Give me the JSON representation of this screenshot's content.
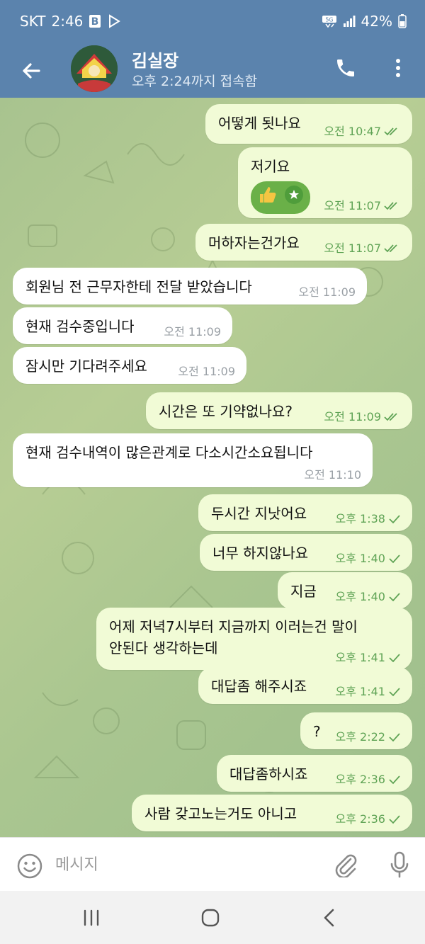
{
  "status_bar": {
    "carrier": "SKT",
    "time": "2:46",
    "battery": "42%"
  },
  "header": {
    "name": "김실장",
    "status": "오후 2:24까지 접속함"
  },
  "messages": [
    {
      "dir": "out",
      "text": "어떻게 됫나요",
      "time": "오전 10:47",
      "read": true
    },
    {
      "dir": "out",
      "text": "저기요",
      "time": "오전 11:07",
      "read": true,
      "emoji": [
        "thumbs-up",
        "star"
      ]
    },
    {
      "dir": "out",
      "text": "머하자는건가요",
      "time": "오전 11:07",
      "read": true
    },
    {
      "dir": "in",
      "text": "회원님 전 근무자한테 전달 받았습니다",
      "time": "오전 11:09"
    },
    {
      "dir": "in",
      "text": "현재 검수중입니다",
      "time": "오전 11:09"
    },
    {
      "dir": "in",
      "text": "잠시만 기다려주세요",
      "time": "오전 11:09"
    },
    {
      "dir": "out",
      "text": "시간은 또 기약없나요?",
      "time": "오전 11:09",
      "read": true
    },
    {
      "dir": "in",
      "text": "현재 검수내역이 많은관계로 다소시간소요됩니다",
      "time": "오전 11:10"
    },
    {
      "dir": "out",
      "text": "두시간 지낫어요",
      "time": "오후 1:38",
      "read": false
    },
    {
      "dir": "out",
      "text": "너무 하지않나요",
      "time": "오후 1:40",
      "read": false
    },
    {
      "dir": "out",
      "text": "지금",
      "time": "오후 1:40",
      "read": false
    },
    {
      "dir": "out",
      "text_line1": "어제 저녁7시부터 지금까지 이러는건 말이",
      "text_line2": "안된다 생각하는데",
      "time": "오후 1:41",
      "read": false
    },
    {
      "dir": "out",
      "text": "대답좀 해주시죠",
      "time": "오후 1:41",
      "read": false
    },
    {
      "dir": "out",
      "text": "?",
      "time": "오후 2:22",
      "read": false
    },
    {
      "dir": "out",
      "text": "대답좀하시죠",
      "time": "오후 2:36",
      "read": false
    },
    {
      "dir": "out",
      "text": "사람 갖고노는거도 아니고",
      "time": "오후 2:36",
      "read": false
    }
  ],
  "input": {
    "placeholder": "메시지"
  },
  "colors": {
    "header": "#5b83ad",
    "outgoing": "#f1fbd6",
    "incoming": "#ffffff",
    "tick": "#5fa355"
  },
  "icons": [
    "back-arrow-icon",
    "phone-icon",
    "more-vert-icon",
    "emoji-icon",
    "attach-icon",
    "mic-icon",
    "recents-icon",
    "home-icon",
    "nav-back-icon"
  ]
}
